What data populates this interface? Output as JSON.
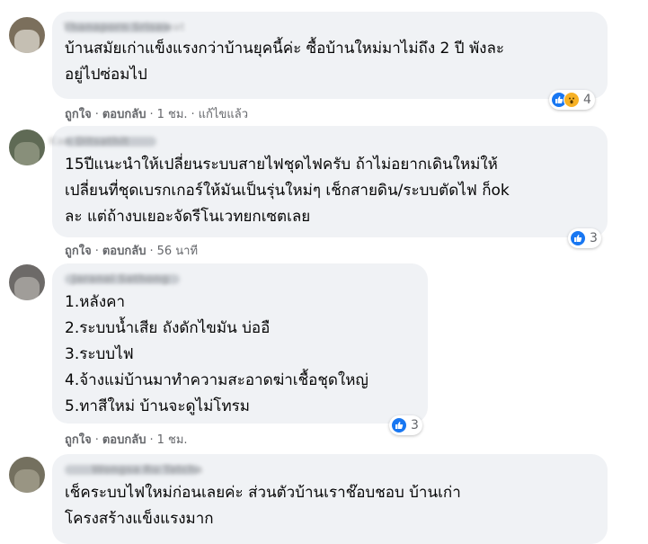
{
  "comments": [
    {
      "author": "Thanaporn Srisawat",
      "text": "บ้านสมัยเก่าแข็งแรงกว่าบ้านยุคนี้ค่ะ ซื้อบ้านใหม่มาไม่ถึง 2 ปี พังละ\nอยู่ไปซ่อมไป",
      "like_label": "ถูกใจ",
      "reply_label": "ตอบกลับ",
      "time": "1 ชม.",
      "edited": "แก้ไขแล้ว",
      "reaction_count": "4",
      "reactions": [
        "like-icon",
        "wow-icon"
      ]
    },
    {
      "author": "Kan Ditsathit",
      "text": "15ปีแนะนำให้เปลี่ยนระบบสายไฟชุดไฟครับ ถ้าไม่อยากเดินใหม่ให้\nเปลี่ยนที่ชุดเบรกเกอร์ให้มันเป็นรุ่นใหม่ๆ เช็กสายดิน/ระบบตัดไฟ ก็ok\nละ แต่ถ้างบเยอะจัดรีโนเวทยกเซตเลย",
      "like_label": "ถูกใจ",
      "reply_label": "ตอบกลับ",
      "time": "56 นาที",
      "reaction_count": "3",
      "reactions": [
        "like-icon"
      ]
    },
    {
      "author": "Jaranai Sathong",
      "text": "1.หลังคา\n2.ระบบน้ำเสีย ถังดักไขมัน บ่ออื\n3.ระบบไฟ\n4.จ้างแม่บ้านมาทำความสะอาดฆ่าเชื้อชุดใหญ่\n5.ทาสีใหม่ บ้านจะดูไม่โทรม",
      "like_label": "ถูกใจ",
      "reply_label": "ตอบกลับ",
      "time": "1 ชม.",
      "reaction_count": "3",
      "reactions": [
        "like-icon"
      ]
    },
    {
      "author": "Wongsa Ru Tatcha",
      "text": "เช็คระบบไฟใหม่ก่อนเลยค่ะ ส่วนตัวบ้านเราช๊อบชอบ บ้านเก่า\nโครงสร้างแข็งแรงมาก"
    }
  ],
  "colors": {
    "bubble": "#f0f2f5",
    "meta": "#65676b",
    "like": "#1877f2",
    "wow": "#f7b125"
  }
}
